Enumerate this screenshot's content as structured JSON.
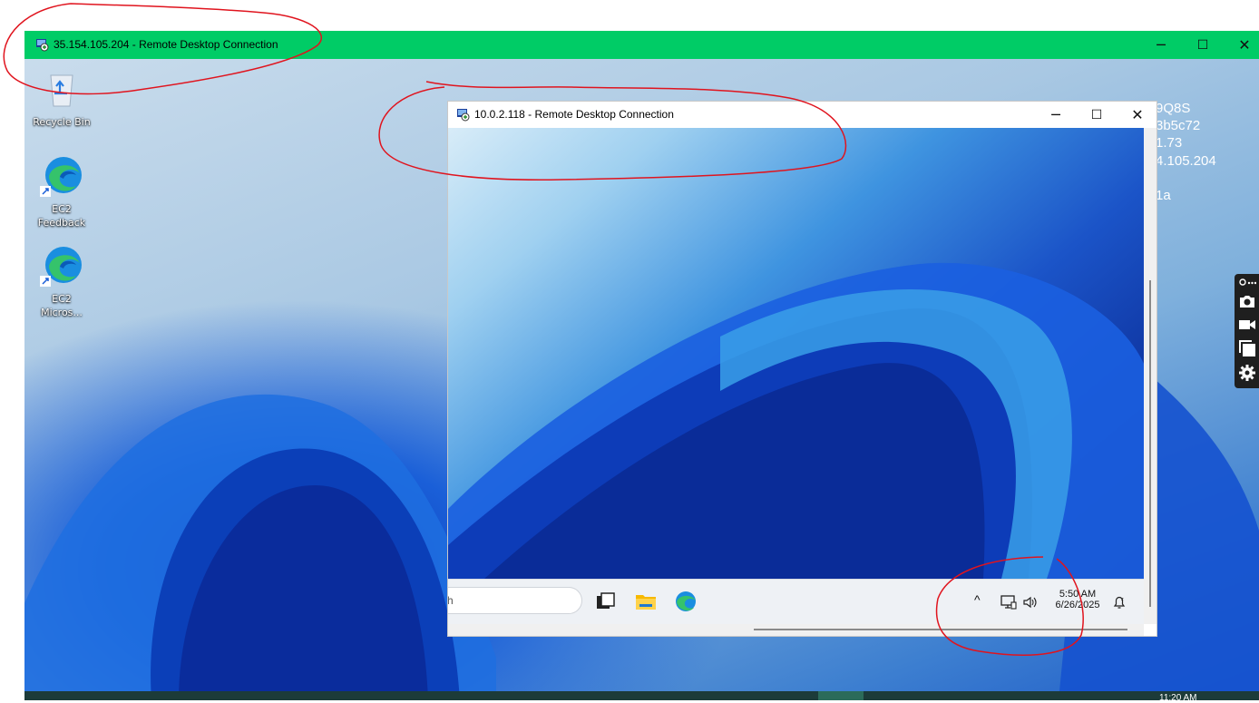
{
  "outer_window": {
    "title": "35.154.105.204 - Remote Desktop Connection",
    "title_bar_color": "#00cc66",
    "minimize": "─",
    "maximize": "☐",
    "close": "✕"
  },
  "desktop_icons": [
    {
      "label": "Recycle Bin",
      "icon": "recycle-bin-icon"
    },
    {
      "label_line1": "EC2",
      "label_line2": "Feedback",
      "icon": "edge-shortcut-icon"
    },
    {
      "label_line1": "EC2",
      "label_line2": "Micros...",
      "icon": "edge-shortcut-icon"
    }
  ],
  "bginfo": [
    "9Q8S",
    "3b5c72",
    "1.73",
    "4.105.204",
    "1a"
  ],
  "inner_window": {
    "title": "10.0.2.118 - Remote Desktop Connection",
    "minimize": "─",
    "maximize": "☐",
    "close": "✕"
  },
  "inner_taskbar": {
    "search_text": "h",
    "tray_chevron": "^",
    "time": "5:50 AM",
    "date": "6/26/2025"
  },
  "host_taskbar": {
    "clock": "11:20 AM"
  },
  "colors": {
    "annotation": "#e0141e",
    "capture_toolbar": "#1f1f1f"
  }
}
